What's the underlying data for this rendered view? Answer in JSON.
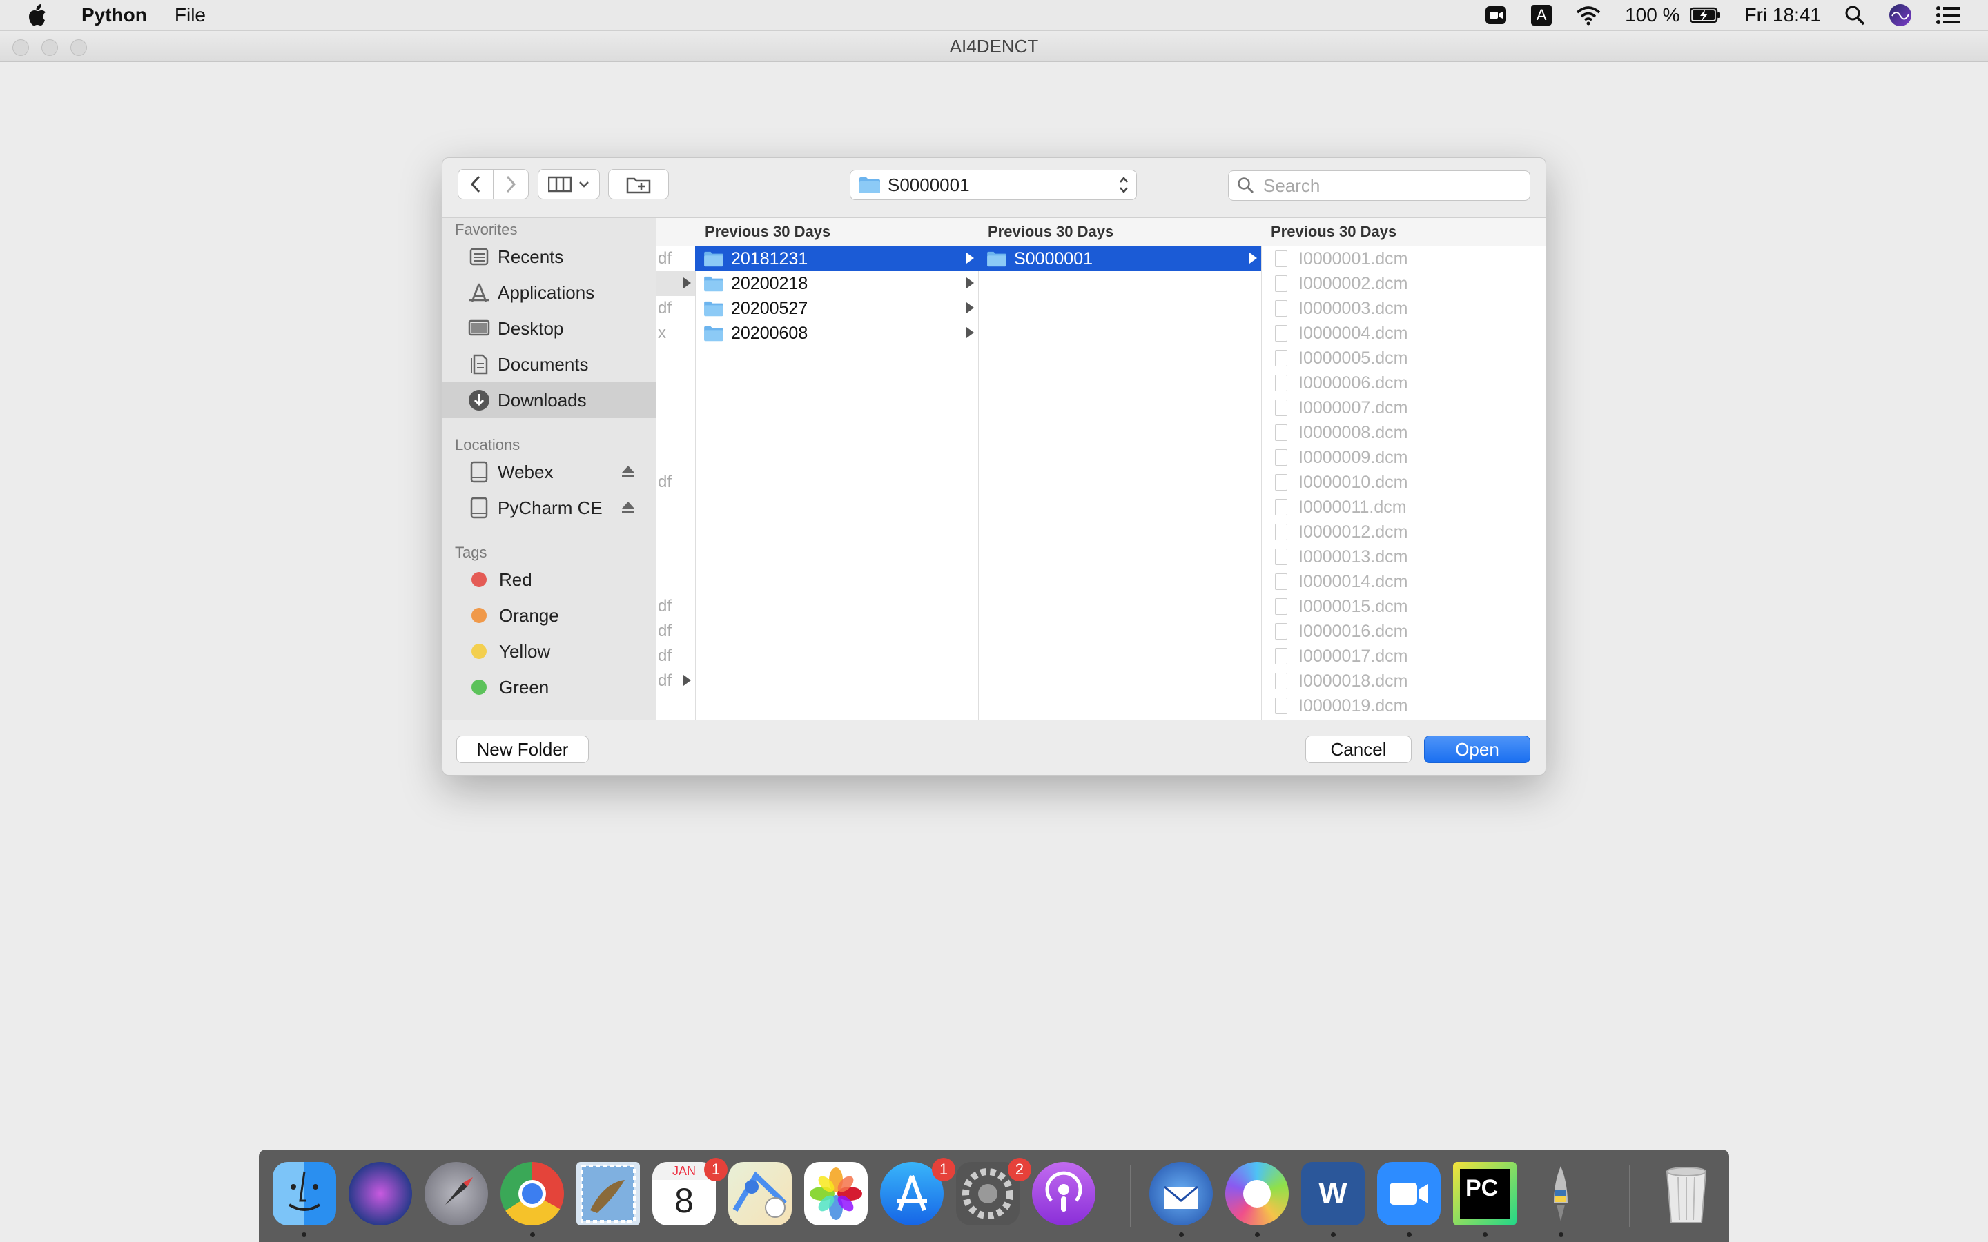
{
  "menubar": {
    "app_name": "Python",
    "menu_file": "File",
    "battery": "100 %",
    "input_source": "A",
    "clock": "Fri 18:41"
  },
  "window": {
    "title": "AI4DENCT"
  },
  "dialog": {
    "location": "S0000001",
    "search_placeholder": "Search",
    "sidebar": {
      "favorites_header": "Favorites",
      "favorites": [
        {
          "label": "Recents",
          "icon": "recents-icon"
        },
        {
          "label": "Applications",
          "icon": "applications-icon"
        },
        {
          "label": "Desktop",
          "icon": "desktop-icon"
        },
        {
          "label": "Documents",
          "icon": "documents-icon"
        },
        {
          "label": "Downloads",
          "icon": "downloads-icon"
        }
      ],
      "locations_header": "Locations",
      "locations": [
        {
          "label": "Webex",
          "icon": "drive-icon"
        },
        {
          "label": "PyCharm CE",
          "icon": "drive-icon"
        }
      ],
      "tags_header": "Tags",
      "tags": [
        {
          "label": "Red",
          "color": "#e45b55"
        },
        {
          "label": "Orange",
          "color": "#f0994a"
        },
        {
          "label": "Yellow",
          "color": "#f3cf4f"
        },
        {
          "label": "Green",
          "color": "#5cc25a"
        }
      ]
    },
    "columns": [
      {
        "header": "Previous 30 Days",
        "items": [
          "20181231",
          "20200218",
          "20200527",
          "20200608"
        ],
        "selected": 0
      },
      {
        "header": "Previous 30 Days",
        "items": [
          "S0000001"
        ],
        "selected": 0
      },
      {
        "header": "Previous 30 Days",
        "files": [
          "I0000001.dcm",
          "I0000002.dcm",
          "I0000003.dcm",
          "I0000004.dcm",
          "I0000005.dcm",
          "I0000006.dcm",
          "I0000007.dcm",
          "I0000008.dcm",
          "I0000009.dcm",
          "I0000010.dcm",
          "I0000011.dcm",
          "I0000012.dcm",
          "I0000013.dcm",
          "I0000014.dcm",
          "I0000015.dcm",
          "I0000016.dcm",
          "I0000017.dcm",
          "I0000018.dcm",
          "I0000019.dcm"
        ]
      }
    ],
    "partial_column": [
      "df",
      "",
      "df",
      "x",
      "",
      "",
      "",
      "",
      "",
      "df",
      "",
      "",
      "",
      "",
      "df",
      "df",
      "df",
      "df"
    ],
    "buttons": {
      "new_folder": "New Folder",
      "cancel": "Cancel",
      "open": "Open"
    }
  },
  "dock": {
    "calendar_month": "JAN",
    "calendar_day": "8",
    "badges": {
      "calendar": "1",
      "app_store": "1",
      "system_prefs": "2"
    },
    "pycharm_label": "PC",
    "word_label": "W"
  }
}
